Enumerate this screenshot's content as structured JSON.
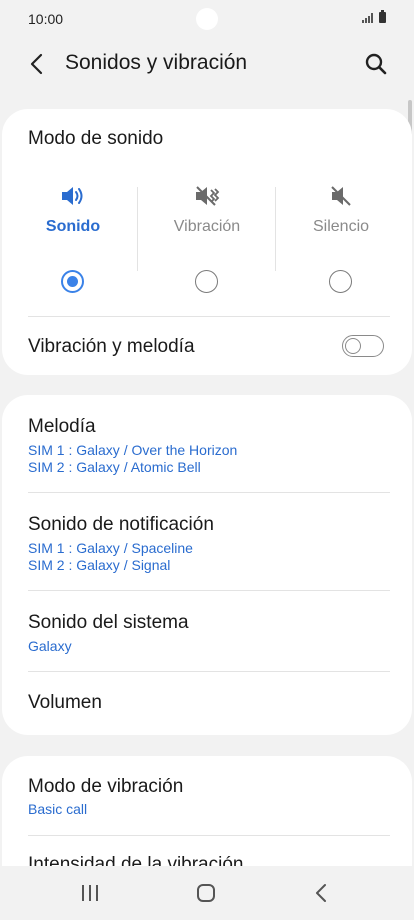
{
  "status": {
    "time": "10:00"
  },
  "header": {
    "title": "Sonidos y vibración",
    "back_icon": "back-arrow-icon",
    "search_icon": "search-icon"
  },
  "sound_mode": {
    "title": "Modo de sonido",
    "options": [
      {
        "label": "Sonido",
        "icon": "speaker-icon",
        "selected": true
      },
      {
        "label": "Vibración",
        "icon": "vibrate-icon",
        "selected": false
      },
      {
        "label": "Silencio",
        "icon": "mute-icon",
        "selected": false
      }
    ],
    "vibrate_ringtone": {
      "label": "Vibración y melodía",
      "enabled": false
    }
  },
  "ringtones": {
    "melody": {
      "title": "Melodía",
      "sim1": "SIM 1 : Galaxy / Over the Horizon",
      "sim2": "SIM 2 : Galaxy / Atomic Bell"
    },
    "notification": {
      "title": "Sonido de notificación",
      "sim1": "SIM 1 : Galaxy / Spaceline",
      "sim2": "SIM 2 : Galaxy / Signal"
    },
    "system": {
      "title": "Sonido del sistema",
      "value": "Galaxy"
    },
    "volume": {
      "title": "Volumen"
    }
  },
  "vibration": {
    "pattern": {
      "title": "Modo de vibración",
      "value": "Basic call"
    },
    "intensity": {
      "title": "Intensidad de la vibración"
    }
  },
  "colors": {
    "accent": "#3a82e8",
    "link": "#2a6ccf",
    "background": "#f2f2f2"
  }
}
